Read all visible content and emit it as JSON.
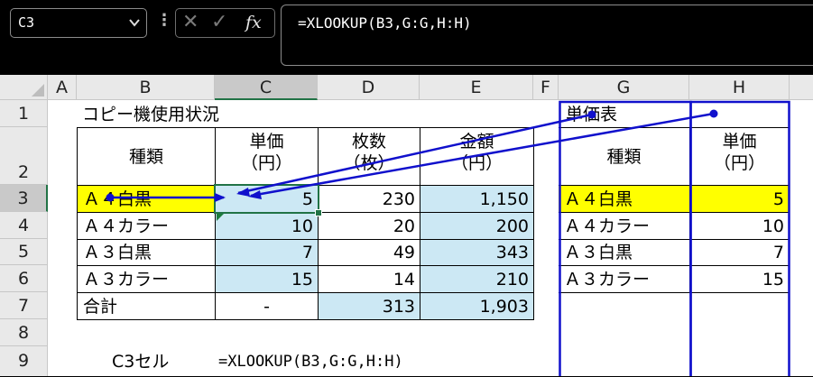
{
  "formula_bar": {
    "name_box": "C3",
    "name_box_dropdown_icon": "chevron-down-icon",
    "more_icon": "vertical-ellipsis-icon",
    "cancel_icon": "cancel-x-icon",
    "enter_icon": "checkmark-icon",
    "function_icon": "fx-icon",
    "cancel_glyph": "✕",
    "enter_glyph": "✓",
    "fx_glyph": "fx",
    "formula": "=XLOOKUP(B3,G:G,H:H)"
  },
  "columns": [
    "A",
    "B",
    "C",
    "D",
    "E",
    "F",
    "G",
    "H"
  ],
  "rows": [
    "1",
    "2",
    "3",
    "4",
    "5",
    "6",
    "7",
    "8",
    "9"
  ],
  "selected_cell": {
    "column": "C",
    "row": "3"
  },
  "main_table": {
    "title": "コピー機使用状況",
    "header": {
      "kind": "種類",
      "unit_price": "単価",
      "unit_price_unit": "（円）",
      "count": "枚数",
      "count_unit": "（枚）",
      "amount": "金額",
      "amount_unit": "（円）"
    },
    "rows": [
      {
        "kind": "Ａ４白黒",
        "unit_price": "5",
        "count": "230",
        "amount": "1,150"
      },
      {
        "kind": "Ａ４カラー",
        "unit_price": "10",
        "count": "20",
        "amount": "200"
      },
      {
        "kind": "Ａ３白黒",
        "unit_price": "7",
        "count": "49",
        "amount": "343"
      },
      {
        "kind": "Ａ３カラー",
        "unit_price": "15",
        "count": "14",
        "amount": "210"
      }
    ],
    "total": {
      "label": "合計",
      "unit_price": "-",
      "count": "313",
      "amount": "1,903"
    }
  },
  "price_table": {
    "title": "単価表",
    "header": {
      "kind": "種類",
      "unit_price": "単価",
      "unit_price_unit": "（円）"
    },
    "rows": [
      {
        "kind": "Ａ４白黒",
        "unit_price": "5"
      },
      {
        "kind": "Ａ４カラー",
        "unit_price": "10"
      },
      {
        "kind": "Ａ３白黒",
        "unit_price": "7"
      },
      {
        "kind": "Ａ３カラー",
        "unit_price": "15"
      }
    ]
  },
  "note": {
    "label": "C3セル",
    "formula": "=XLOOKUP(B3,G:G,H:H)"
  },
  "colors": {
    "highlight_yellow": "#ffff00",
    "formula_cell_blue": "#cce8f4",
    "trace_arrow_blue": "#1010cc",
    "selection_green": "#217346"
  }
}
